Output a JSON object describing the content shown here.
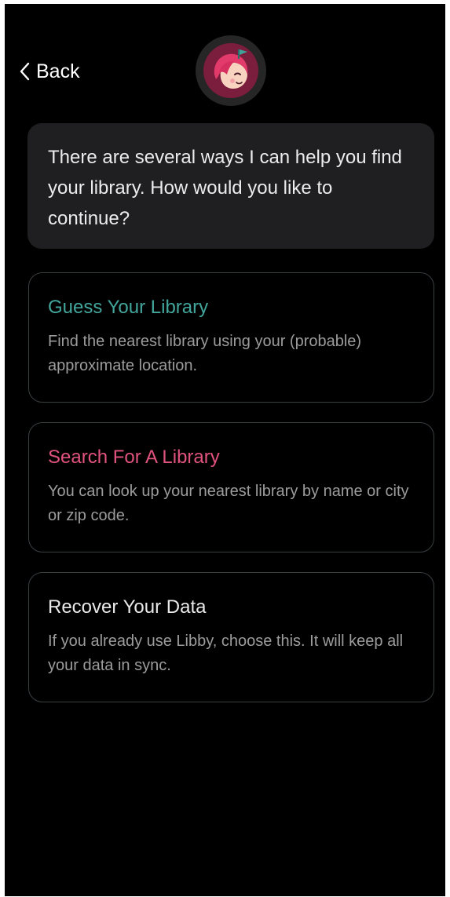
{
  "header": {
    "back_label": "Back",
    "back_icon": "chevron-left-icon",
    "avatar_icon": "libby-avatar-icon"
  },
  "prompt": {
    "text": "There are several ways I can help you find your library. How would you like to continue?"
  },
  "options": [
    {
      "title": "Guess Your Library",
      "description": "Find the nearest library using your (probable) approximate location.",
      "title_color": "#43a69c"
    },
    {
      "title": "Search For A Library",
      "description": "You can look up your nearest library by name or city or zip code.",
      "title_color": "#e0537e"
    },
    {
      "title": "Recover Your Data",
      "description": "If you already use Libby, choose this. It will keep all your data in sync.",
      "title_color": "#e9e9e9"
    }
  ],
  "colors": {
    "background": "#000000",
    "bubble": "#1f1f21",
    "card_border": "#3a3f42",
    "avatar_bg": "#7b1d3c"
  }
}
